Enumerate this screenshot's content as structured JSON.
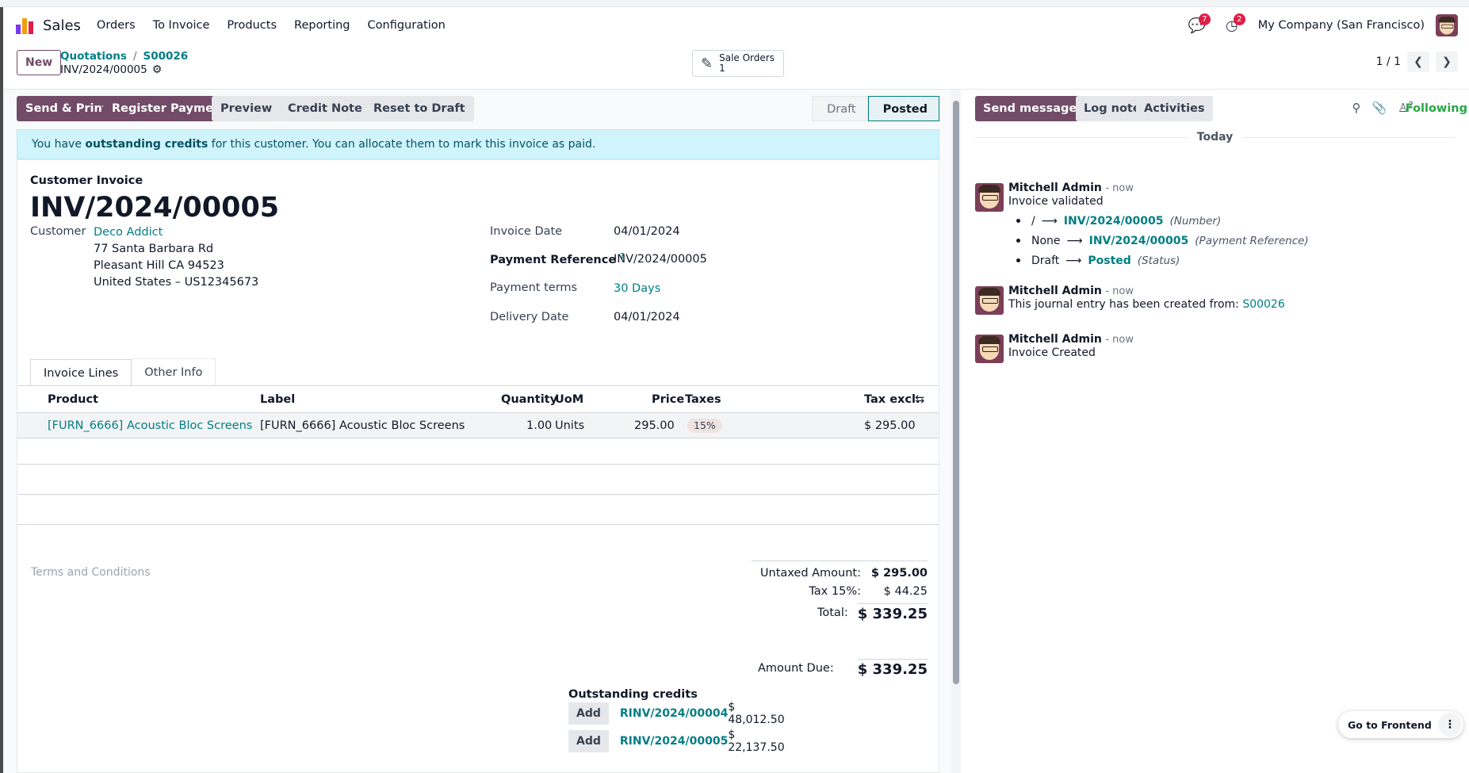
{
  "navbar": {
    "app_name": "Sales",
    "menu": [
      "Orders",
      "To Invoice",
      "Products",
      "Reporting",
      "Configuration"
    ],
    "messages_badge": "7",
    "activities_badge": "2",
    "company": "My Company (San Francisco)",
    "colors": {
      "icon1": "#e11d48",
      "icon2": "#f59e0b",
      "icon3": "#7c3aed"
    }
  },
  "control_panel": {
    "new_label": "New",
    "breadcrumb": [
      "Quotations",
      "S00026"
    ],
    "record_name": "INV/2024/00005",
    "smart_button": {
      "label": "Sale Orders",
      "count": "1"
    },
    "pager": "1 / 1"
  },
  "statusbar": {
    "buttons": [
      "Send & Print",
      "Register Payment",
      "Preview",
      "Credit Note",
      "Reset to Draft"
    ],
    "steps": [
      "Draft",
      "Posted"
    ],
    "active_step": "Posted"
  },
  "alert": {
    "pre": "You have ",
    "bold": "outstanding credits",
    "post": " for this customer. You can allocate them to mark this invoice as paid."
  },
  "invoice": {
    "type": "Customer Invoice",
    "name": "INV/2024/00005",
    "customer_label": "Customer",
    "customer_name": "Deco Addict",
    "address": [
      "77 Santa Barbara Rd",
      "Pleasant Hill CA 94523",
      "United States – US12345673"
    ],
    "invoice_date_label": "Invoice Date",
    "invoice_date": "04/01/2024",
    "payment_ref_label": "Payment Reference",
    "payment_ref_help": "?",
    "payment_ref": "INV/2024/00005",
    "payment_terms_label": "Payment terms",
    "payment_terms": "30 Days",
    "delivery_date_label": "Delivery Date",
    "delivery_date": "04/01/2024"
  },
  "tabs": [
    "Invoice Lines",
    "Other Info"
  ],
  "lines": {
    "headers": {
      "product": "Product",
      "label": "Label",
      "quantity": "Quantity",
      "uom": "UoM",
      "price": "Price",
      "taxes": "Taxes",
      "tax_excl": "Tax excl."
    },
    "rows": [
      {
        "product": "[FURN_6666] Acoustic Bloc Screens",
        "label": "[FURN_6666] Acoustic Bloc Screens",
        "quantity": "1.00",
        "uom": "Units",
        "price": "295.00",
        "taxes": "15%",
        "tax_excl": "$ 295.00"
      }
    ]
  },
  "terms_placeholder": "Terms and Conditions",
  "totals": {
    "untaxed_label": "Untaxed Amount:",
    "untaxed": "$ 295.00",
    "tax_label": "Tax 15%:",
    "tax": "$ 44.25",
    "total_label": "Total:",
    "total": "$ 339.25",
    "due_label": "Amount Due:",
    "due": "$ 339.25"
  },
  "credits": {
    "title": "Outstanding credits",
    "add_label": "Add",
    "items": [
      {
        "ref": "RINV/2024/00004",
        "amount": "$ 48,012.50"
      },
      {
        "ref": "RINV/2024/00005",
        "amount": "$ 22,137.50"
      }
    ]
  },
  "chatter": {
    "send_message": "Send message",
    "log_note": "Log note",
    "activities": "Activities",
    "followers_count": "2",
    "following": "Following",
    "today": "Today",
    "messages": [
      {
        "author": "Mitchell Admin",
        "when": "- now",
        "text": "Invoice validated",
        "tracking": [
          {
            "old": "/",
            "new": "INV/2024/00005",
            "field": "(Number)"
          },
          {
            "old": "None",
            "new": "INV/2024/00005",
            "field": "(Payment Reference)"
          },
          {
            "old": "Draft",
            "new": "Posted",
            "field": "(Status)"
          }
        ]
      },
      {
        "author": "Mitchell Admin",
        "when": "- now",
        "text": "This journal entry has been created from: ",
        "link": "S00026"
      },
      {
        "author": "Mitchell Admin",
        "when": "- now",
        "text": "Invoice Created"
      }
    ]
  },
  "go_frontend": "Go to Frontend"
}
